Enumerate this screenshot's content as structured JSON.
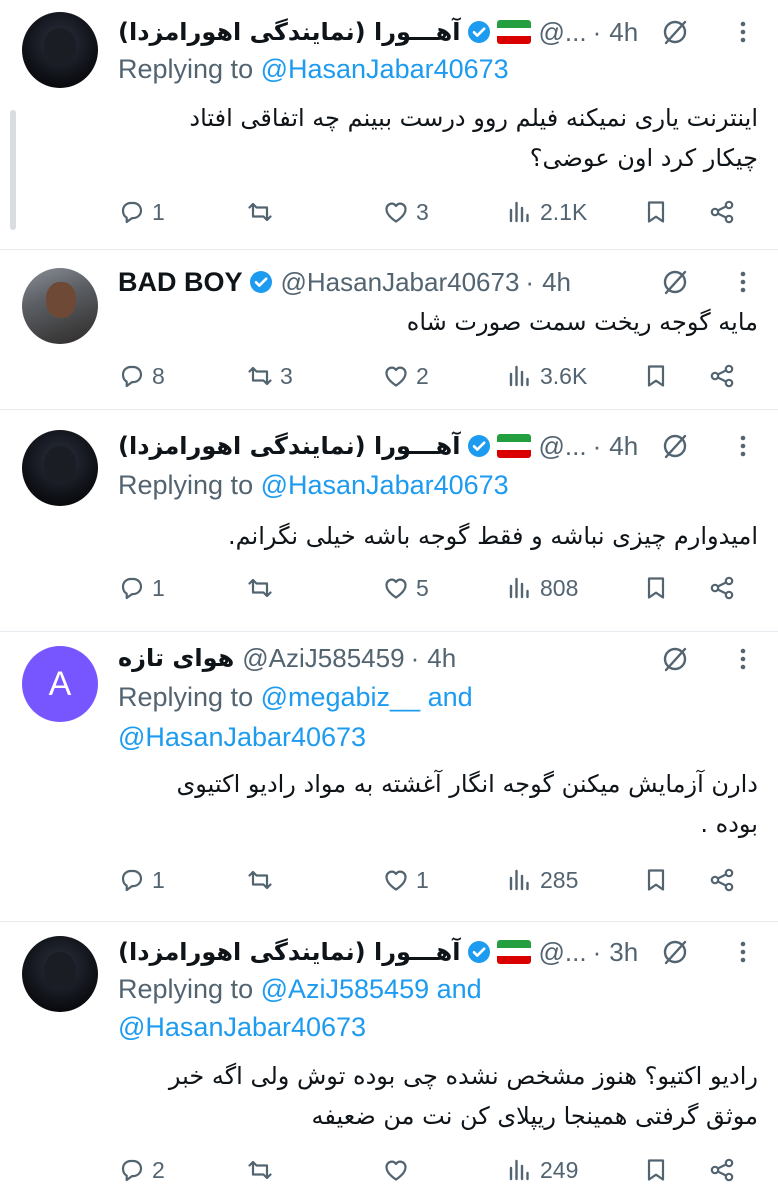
{
  "tweets": [
    {
      "avatar": "masked-figure-avatar",
      "name": "آهـــورا (نمایندگی اهورامزدا)",
      "verified": true,
      "flag": true,
      "handle": "@...",
      "dot": "·",
      "time": "4h",
      "reply_prefix": "Replying to ",
      "reply_mentions": "@HasanJabar40673",
      "reply_line2": "",
      "text": "اینترنت یاری نمیکنه فیلم روو درست ببینم چه اتفاقی افتاد\nچیکار کرد اون عوضی؟",
      "stats": {
        "replies": "1",
        "retweets": "",
        "likes": "3",
        "views": "2.1K"
      }
    },
    {
      "avatar": "man-photo-avatar",
      "name": "BAD BOY",
      "verified": true,
      "flag": false,
      "handle": "@HasanJabar40673",
      "dot": "·",
      "time": "4h",
      "reply_prefix": "",
      "reply_mentions": "",
      "reply_line2": "",
      "text": "مایه گوجه ریخت سمت صورت شاه",
      "stats": {
        "replies": "8",
        "retweets": "3",
        "likes": "2",
        "views": "3.6K"
      }
    },
    {
      "avatar": "masked-figure-avatar",
      "name": "آهـــورا (نمایندگی اهورامزدا)",
      "verified": true,
      "flag": true,
      "handle": "@...",
      "dot": "·",
      "time": "4h",
      "reply_prefix": "Replying to ",
      "reply_mentions": "@HasanJabar40673",
      "reply_line2": "",
      "text": "امیدوارم چیزی نباشه و فقط گوجه باشه خیلی نگرانم.",
      "stats": {
        "replies": "1",
        "retweets": "",
        "likes": "5",
        "views": "808"
      }
    },
    {
      "avatar": "A",
      "name": "هوای تازه",
      "verified": false,
      "flag": false,
      "handle": "@AziJ585459",
      "dot": "·",
      "time": "4h",
      "reply_prefix": "Replying to ",
      "reply_mentions": "@megabiz__ and",
      "reply_line2": "@HasanJabar40673",
      "text": "دارن آزمایش میکنن گوجه انگار آغشته به مواد رادیو اکتیوی\nبوده .",
      "stats": {
        "replies": "1",
        "retweets": "",
        "likes": "1",
        "views": "285"
      }
    },
    {
      "avatar": "masked-figure-avatar",
      "name": "آهـــورا (نمایندگی اهورامزدا)",
      "verified": true,
      "flag": true,
      "handle": "@...",
      "dot": "·",
      "time": "3h",
      "reply_prefix": "Replying to ",
      "reply_mentions": "@AziJ585459 and",
      "reply_line2": "@HasanJabar40673",
      "text": "رادیو اکتیو؟ هنوز مشخص نشده چی بوده توش ولی اگه خبر\nموثق گرفتی همینجا ریپلای کن نت من ضعیفه",
      "stats": {
        "replies": "2",
        "retweets": "",
        "likes": "",
        "views": "249"
      }
    }
  ],
  "colors": {
    "accent": "#1d9bf0",
    "muted": "#536471",
    "text": "#0f1419",
    "letter_avatar": "#7856ff",
    "flag_green": "#239f40",
    "flag_white": "#ffffff",
    "flag_red": "#da0000"
  },
  "icons": {
    "reply": "speech-bubble-icon",
    "retweet": "retweet-arrows-icon",
    "like": "heart-icon",
    "views": "bar-chart-icon",
    "bookmark": "bookmark-icon",
    "share": "share-icon",
    "grok": "grok-slash-circle-icon",
    "more": "more-dots-icon",
    "verified": "verified-badge-icon"
  }
}
